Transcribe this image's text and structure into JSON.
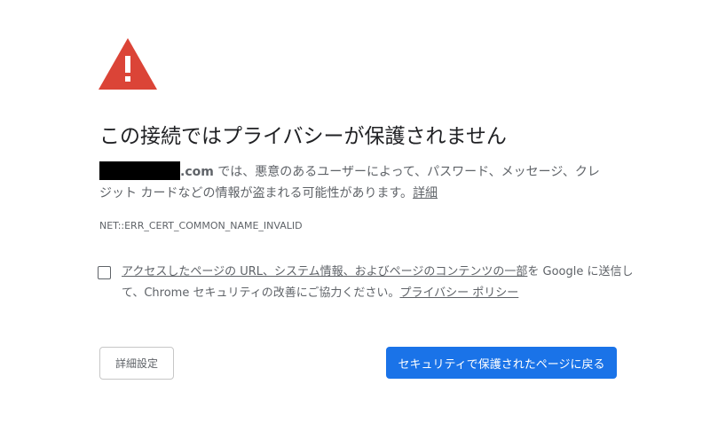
{
  "icon": {
    "name": "warning-triangle-icon",
    "color": "#db4437"
  },
  "heading": "この接続ではプライバシーが保護されません",
  "description": {
    "domain_suffix": ".com",
    "line1_rest": " では、悪意のあるユーザーによって、パスワード、メッセージ、クレ",
    "line2": "ジット カードなどの情報が盗まれる可能性があります。",
    "details_link": "詳細"
  },
  "error_code": "NET::ERR_CERT_COMMON_NAME_INVALID",
  "opt_in": {
    "link_text": "アクセスしたページの URL、システム情報、およびページのコンテンツの一部",
    "line1_rest": "を Google に送信し",
    "line2": "て、Chrome セキュリティの改善にご協力ください。",
    "privacy_link": "プライバシー ポリシー",
    "checked": false
  },
  "buttons": {
    "advanced": "詳細設定",
    "back_to_safety": "セキュリティで保護されたページに戻る"
  },
  "colors": {
    "primary_button": "#1a73e8",
    "warning_red": "#db4437",
    "body_text": "#5f6368",
    "heading_text": "#202124"
  }
}
